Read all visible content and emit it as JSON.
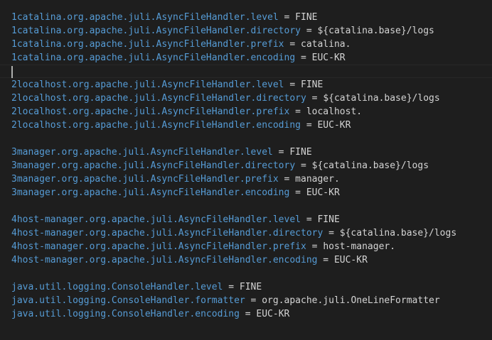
{
  "colors": {
    "background": "#1e1e1e",
    "key": "#569cd6",
    "text": "#d4d4d4",
    "cursor": "#aeafad"
  },
  "editor": {
    "lines": [
      {
        "key": "1catalina.org.apache.juli.AsyncFileHandler.level",
        "op": " = ",
        "value": "FINE"
      },
      {
        "key": "1catalina.org.apache.juli.AsyncFileHandler.directory",
        "op": " = ",
        "value": "${catalina.base}/logs"
      },
      {
        "key": "1catalina.org.apache.juli.AsyncFileHandler.prefix",
        "op": " = ",
        "value": "catalina."
      },
      {
        "key": "1catalina.org.apache.juli.AsyncFileHandler.encoding",
        "op": " = ",
        "value": "EUC-KR"
      },
      {
        "key": "",
        "op": "",
        "value": ""
      },
      {
        "key": "2localhost.org.apache.juli.AsyncFileHandler.level",
        "op": " = ",
        "value": "FINE"
      },
      {
        "key": "2localhost.org.apache.juli.AsyncFileHandler.directory",
        "op": " = ",
        "value": "${catalina.base}/logs"
      },
      {
        "key": "2localhost.org.apache.juli.AsyncFileHandler.prefix",
        "op": " = ",
        "value": "localhost."
      },
      {
        "key": "2localhost.org.apache.juli.AsyncFileHandler.encoding",
        "op": " = ",
        "value": "EUC-KR"
      },
      {
        "key": "",
        "op": "",
        "value": ""
      },
      {
        "key": "3manager.org.apache.juli.AsyncFileHandler.level",
        "op": " = ",
        "value": "FINE"
      },
      {
        "key": "3manager.org.apache.juli.AsyncFileHandler.directory",
        "op": " = ",
        "value": "${catalina.base}/logs"
      },
      {
        "key": "3manager.org.apache.juli.AsyncFileHandler.prefix",
        "op": " = ",
        "value": "manager."
      },
      {
        "key": "3manager.org.apache.juli.AsyncFileHandler.encoding",
        "op": " = ",
        "value": "EUC-KR"
      },
      {
        "key": "",
        "op": "",
        "value": ""
      },
      {
        "key": "4host-manager.org.apache.juli.AsyncFileHandler.level",
        "op": " = ",
        "value": "FINE"
      },
      {
        "key": "4host-manager.org.apache.juli.AsyncFileHandler.directory",
        "op": " = ",
        "value": "${catalina.base}/logs"
      },
      {
        "key": "4host-manager.org.apache.juli.AsyncFileHandler.prefix",
        "op": " = ",
        "value": "host-manager."
      },
      {
        "key": "4host-manager.org.apache.juli.AsyncFileHandler.encoding",
        "op": " = ",
        "value": "EUC-KR"
      },
      {
        "key": "",
        "op": "",
        "value": ""
      },
      {
        "key": "java.util.logging.ConsoleHandler.level",
        "op": " = ",
        "value": "FINE"
      },
      {
        "key": "java.util.logging.ConsoleHandler.formatter",
        "op": " = ",
        "value": "org.apache.juli.OneLineFormatter"
      },
      {
        "key": "java.util.logging.ConsoleHandler.encoding",
        "op": " = ",
        "value": "EUC-KR"
      }
    ]
  }
}
